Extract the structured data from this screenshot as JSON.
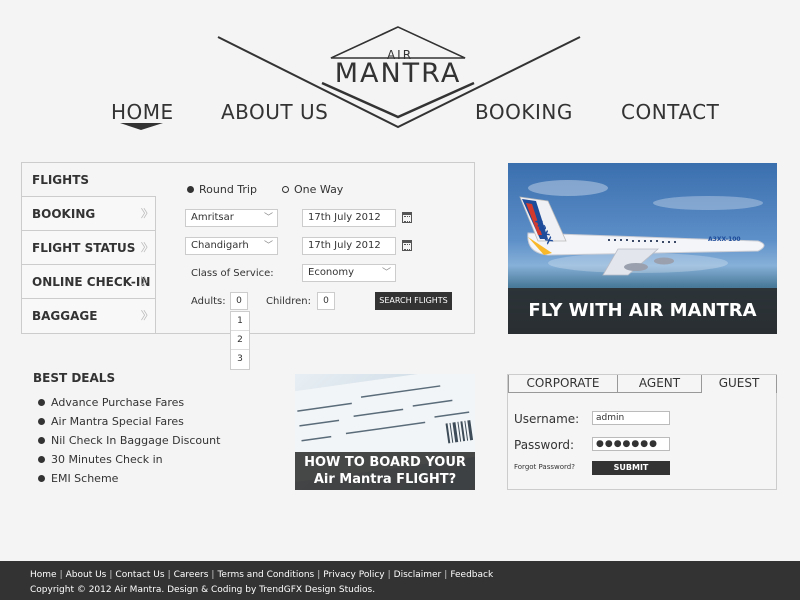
{
  "logo": {
    "air": "AIR",
    "name": "MANTRA"
  },
  "nav": {
    "home": "HOME",
    "about": "ABOUT US",
    "booking": "BOOKING",
    "contact": "CONTACT"
  },
  "flight_tabs": [
    "FLIGHTS",
    "BOOKING",
    "FLIGHT STATUS",
    "ONLINE CHECK-IN",
    "BAGGAGE"
  ],
  "trip": {
    "round": "Round Trip",
    "oneway": "One Way"
  },
  "form": {
    "from": "Amritsar",
    "to": "Chandigarh",
    "date1": "17th July 2012",
    "date2": "17th July 2012",
    "class_label": "Class of Service:",
    "class_value": "Economy",
    "adults_label": "Adults:",
    "adults_value": "0",
    "children_label": "Children:",
    "children_value": "0",
    "search": "SEARCH FLIGHTS",
    "adults_options": [
      "1",
      "2",
      "3"
    ]
  },
  "promo": {
    "plane": "FLY WITH AIR MANTRA",
    "plane_tail": "A3XX",
    "plane_body": "A3XX-100",
    "ticket_line1": "HOW TO BOARD YOUR",
    "ticket_line2": "Air Mantra FLIGHT?"
  },
  "deals": {
    "title": "BEST DEALS",
    "items": [
      "Advance Purchase Fares",
      "Air Mantra Special Fares",
      "Nil Check In Baggage Discount",
      "30 Minutes Check in",
      "EMI Scheme"
    ]
  },
  "login": {
    "tabs": [
      "CORPORATE",
      "AGENT",
      "GUEST"
    ],
    "username_label": "Username:",
    "username_value": "admin",
    "password_label": "Password:",
    "password_value": "●●●●●●●",
    "forgot": "Forgot Password?",
    "submit": "SUBMIT"
  },
  "footer": {
    "links": [
      "Home",
      "About Us",
      "Contact Us",
      "Careers",
      "Terms and Conditions",
      "Privacy Policy",
      "Disclaimer",
      "Feedback"
    ],
    "copyright": "Copyright © 2012 Air Mantra. Design & Coding by TrendGFX Design Studios."
  }
}
